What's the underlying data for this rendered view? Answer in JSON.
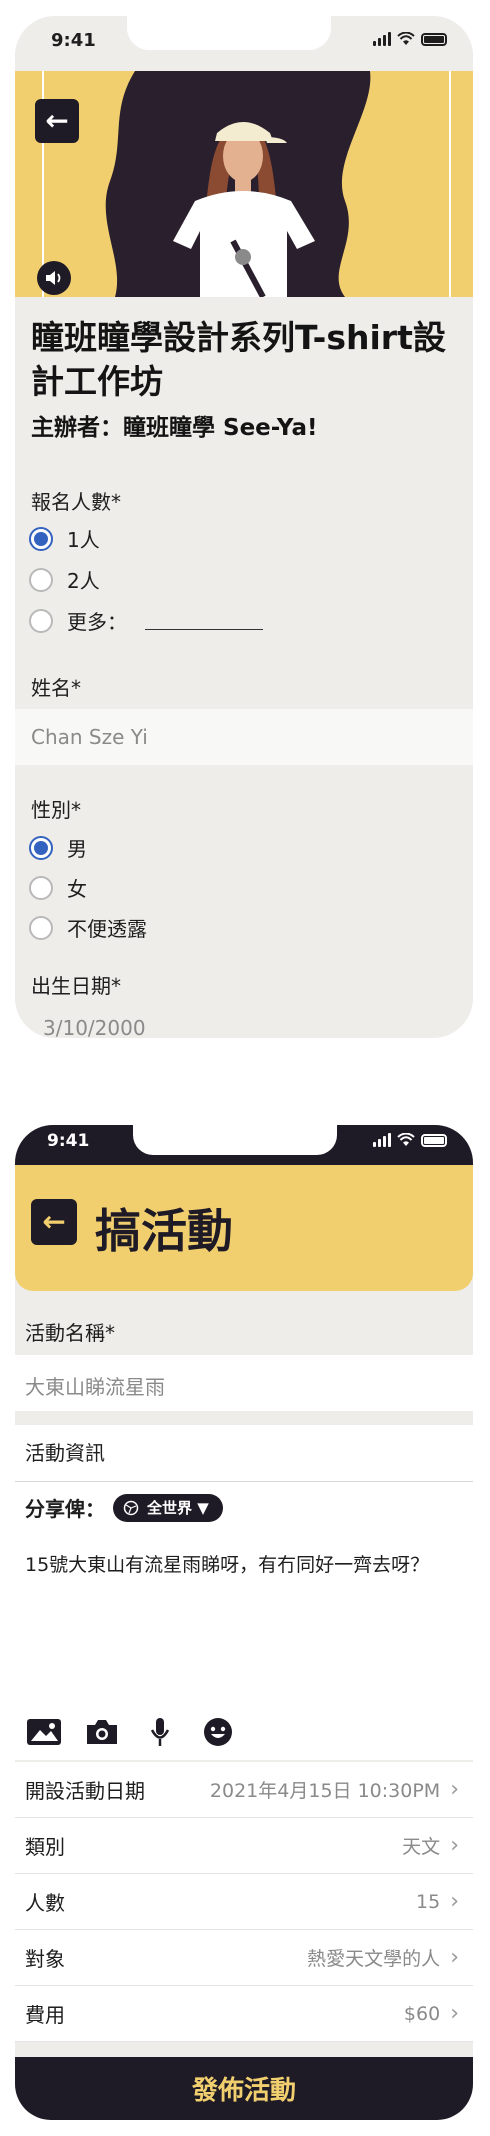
{
  "status_bar": {
    "time": "9:41"
  },
  "registration": {
    "event_title": "瞳班瞳學設計系列T-shirt設計工作坊",
    "organizer": "主辦者：瞳班瞳學 See-Ya!",
    "headcount": {
      "label": "報名人數*",
      "options": [
        "1人",
        "2人",
        "更多："
      ],
      "selected": "1人"
    },
    "name": {
      "label": "姓名*",
      "value": "Chan Sze Yi"
    },
    "gender": {
      "label": "性別*",
      "options": [
        "男",
        "女",
        "不便透露"
      ],
      "selected": "男"
    },
    "dob": {
      "label": "出生日期*",
      "value": "3/10/2000"
    }
  },
  "create_event": {
    "title": "搞活動",
    "name": {
      "label": "活動名稱*",
      "value": "大東山睇流星雨"
    },
    "info": {
      "label": "活動資訊"
    },
    "share": {
      "label": "分享俾：",
      "scope": "全世界 ▼"
    },
    "post_text": "15號大東山有流星雨睇呀，有冇同好一齊去呀？",
    "toolbar_icons": [
      "image-icon",
      "camera-icon",
      "microphone-icon",
      "emoji-icon"
    ],
    "details": [
      {
        "label": "開設活動日期",
        "value": "2021年4月15日 10:30PM"
      },
      {
        "label": "類別",
        "value": "天文"
      },
      {
        "label": "人數",
        "value": "15"
      },
      {
        "label": "對象",
        "value": "熱愛天文學的人"
      },
      {
        "label": "費用",
        "value": "$60"
      }
    ],
    "publish_label": "發佈活動"
  },
  "colors": {
    "accent_yellow": "#f1cf6f",
    "dark": "#1f1b26",
    "radio_blue": "#3462bf",
    "background": "#eeede9"
  }
}
